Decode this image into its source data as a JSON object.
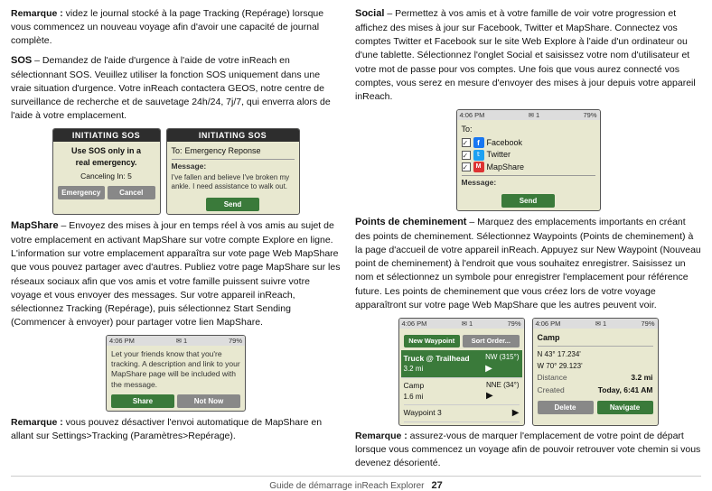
{
  "page": {
    "footer_text": "Guide de démarrage inReach Explorer",
    "page_number": "27"
  },
  "left_col": {
    "remark_intro": "Remarque :",
    "remark_text1": " videz le journal stocké à la page Tracking (Repérage) lorsque vous commencez un nouveau voyage afin d'avoir une capacité de journal complète.",
    "sos_label": "SOS",
    "sos_text": " – Demandez de l'aide d'urgence à l'aide de votre inReach en sélectionnant SOS. Veuillez utiliser la fonction SOS uniquement dans une vraie situation d'urgence. Votre inReach contactera GEOS, notre centre de surveillance de recherche et de sauvetage 24h/24, 7j/7, qui enverra alors de l'aide à votre emplacement.",
    "sos_screen1": {
      "header": "INITIATING SOS",
      "line1": "Use SOS only in a",
      "line2": "real emergency.",
      "line3": "Canceling In: 5",
      "btn1": "Emergency",
      "btn2": "Cancel"
    },
    "sos_screen2": {
      "header": "INITIATING SOS",
      "to_label": "To:",
      "to_value": "Emergency Reponse",
      "message_label": "Message:",
      "message_text": "I've fallen and believe I've broken my ankle. I need assistance to walk out.",
      "btn_send": "Send"
    },
    "mapshare_label": "MapShare",
    "mapshare_text": " – Envoyez des mises à jour en temps réel à vos amis au sujet de votre emplacement en activant MapShare sur votre compte Explore en ligne. L'information sur votre emplacement apparaîtra sur vote page Web MapShare que vous pouvez partager avec d'autres. Publiez votre page MapShare sur les réseaux sociaux afin que vos amis et votre famille puissent suivre votre voyage et vous envoyer des messages. Sur votre appareil inReach, sélectionnez Tracking (Repérage), puis sélectionnez Start Sending (Commencer à envoyer) pour partager votre lien MapShare.",
    "mapshare_screen": {
      "status_time": "4:06 PM",
      "status_signal": "1",
      "status_battery": "79%",
      "body_text": "Let your friends know that you're tracking. A description and link to your MapShare page will be included with the message.",
      "btn_share": "Share",
      "btn_notnow": "Not Now"
    },
    "remark2_label": "Remarque :",
    "remark2_text": " vous pouvez désactiver l'envoi automatique de MapShare en allant sur Settings>Tracking (Paramètres>Repérage)."
  },
  "right_col": {
    "social_label": "Social",
    "social_text": " – Permettez à vos amis et à votre famille de voir votre progression et affichez des mises à jour sur Facebook, Twitter et MapShare. Connectez vos comptes Twitter et Facebook sur le site Web Explore à l'aide d'un ordinateur ou d'une tablette. Sélectionnez l'onglet Social et saisissez votre nom d'utilisateur et votre mot de passe pour vos comptes. Une fois que vous aurez connecté vos comptes, vous serez en mesure d'envoyer des mises à jour depuis votre appareil inReach.",
    "social_screen": {
      "status_time": "4:06 PM",
      "status_signal": "1",
      "status_battery": "79%",
      "to_label": "To:",
      "facebook_label": "Facebook",
      "twitter_label": "Twitter",
      "mapshare_label": "MapShare",
      "message_label": "Message:",
      "btn_send": "Send"
    },
    "waypoints_label": "Points de cheminement",
    "waypoints_text": " – Marquez des emplacements importants en créant des points de cheminement. Sélectionnez Waypoints (Points de cheminement) à la page d'accueil de votre appareil inReach. Appuyez sur New Waypoint (Nouveau point de cheminement) à l'endroit que vous souhaitez enregistrer. Saisissez un nom et sélectionnez un symbole pour enregistrer l'emplacement pour référence future. Les points de cheminement que vous créez lors de votre voyage apparaîtront sur votre page Web MapShare que les autres peuvent voir.",
    "wp_screen1": {
      "status_time": "4:06 PM",
      "status_signal": "1",
      "status_battery": "79%",
      "btn_new": "New Waypoint",
      "btn_sort": "Sort Order...",
      "item1_name": "Truck @ Trailhead",
      "item1_dist": "3.2 mi",
      "item1_bearing": "NW (315°)",
      "item2_name": "Camp",
      "item2_dist": "1.6 mi",
      "item2_bearing": "NNE (34°)",
      "item3_name": "Waypoint 3"
    },
    "wp_screen2": {
      "status_time": "4:06 PM",
      "status_signal": "1",
      "status_battery": "79%",
      "name": "Camp",
      "lat": "N 43° 17.234'",
      "lon": "W 70° 29.123'",
      "dist_label": "Distance",
      "dist_value": "3.2 mi",
      "created_label": "Created",
      "created_value": "Today, 6:41 AM",
      "btn_delete": "Delete",
      "btn_navigate": "Navigate"
    },
    "remark3_label": "Remarque :",
    "remark3_text": " assurez-vous de marquer l'emplacement de votre point de départ lorsque vous commencez un voyage afin de pouvoir retrouver vote chemin si vous devenez désorienté."
  }
}
